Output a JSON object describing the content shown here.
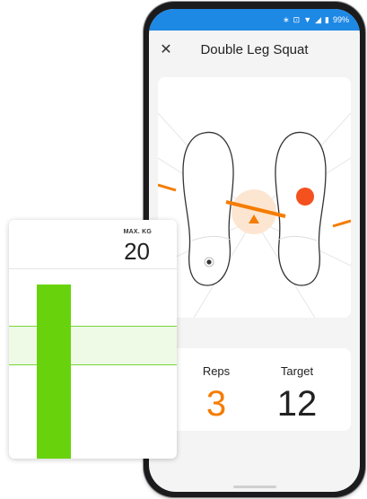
{
  "status_bar": {
    "battery": "99%",
    "icons": [
      "bluetooth-icon",
      "vibrate-icon",
      "wifi-icon",
      "signal-icon",
      "battery-icon"
    ]
  },
  "app_bar": {
    "title": "Double Leg Squat",
    "close_icon": "close-icon"
  },
  "balance": {
    "pressure_colors": {
      "left": "#333333",
      "right": "#f4511e"
    },
    "indicator_color": "#f57c00"
  },
  "stats": {
    "reps_label": "Reps",
    "reps_value": "3",
    "target_label": "Target",
    "target_value": "12"
  },
  "colors": {
    "accent": "#f57c00",
    "status_bar": "#1e88e5",
    "bar": "#68d30c",
    "band_line": "#76d63a"
  },
  "chart_card": {
    "label": "MAX. KG",
    "value": "20"
  },
  "chart_data": {
    "type": "bar",
    "categories": [
      ""
    ],
    "values": [
      20
    ],
    "target_band": [
      10,
      14
    ],
    "ylim": [
      0,
      20
    ]
  }
}
